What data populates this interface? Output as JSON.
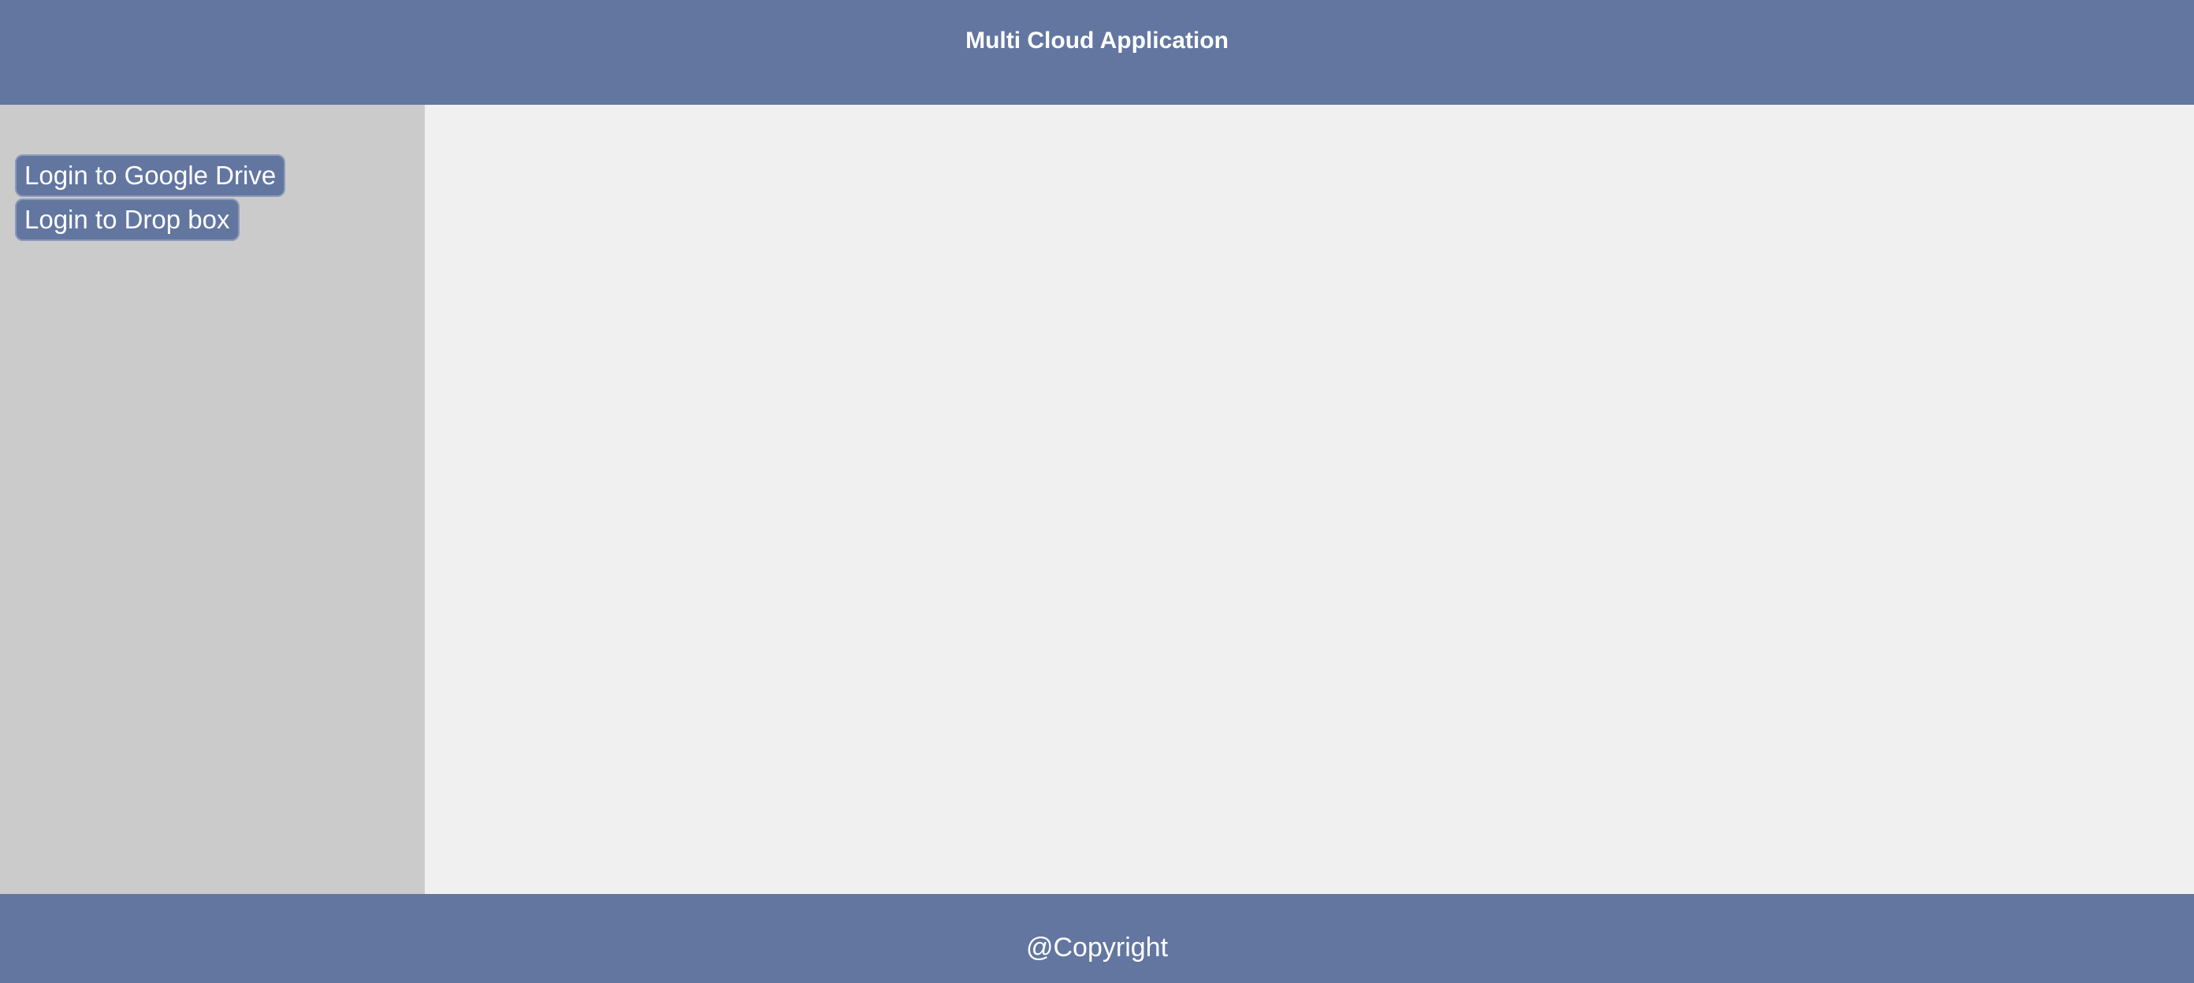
{
  "header": {
    "title": "Multi Cloud Application"
  },
  "sidebar": {
    "buttons": [
      {
        "label": "Login to Google Drive"
      },
      {
        "label": "Login to Drop box"
      }
    ]
  },
  "footer": {
    "text": "@Copyright"
  },
  "colors": {
    "accent": "#6276a0",
    "sidebar_bg": "#cbcbcb",
    "main_bg": "#f0f0f1",
    "text_light": "#ffffff"
  }
}
